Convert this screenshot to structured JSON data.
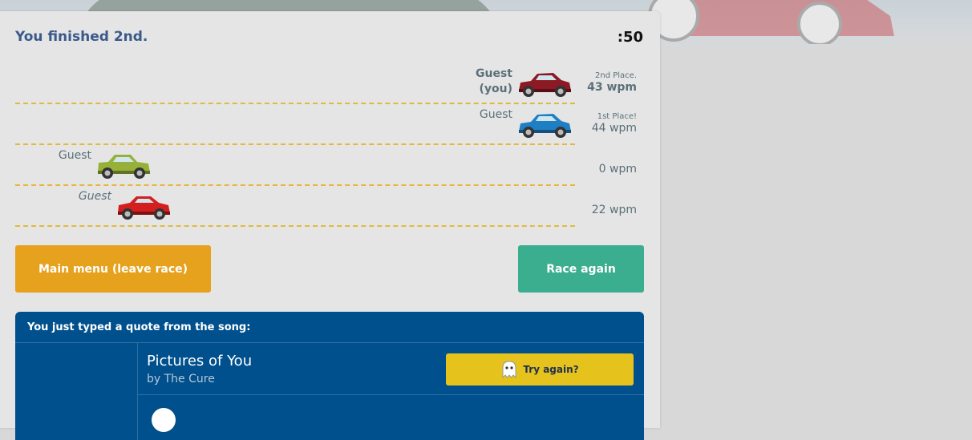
{
  "header": {
    "status": "You finished 2nd.",
    "timer": ":50"
  },
  "lanes": [
    {
      "name_line1": "Guest",
      "name_line2": "(you)",
      "car_color": "#8b1a24",
      "place": "2nd Place.",
      "wpm": "43 wpm"
    },
    {
      "name_line1": "Guest",
      "car_color": "#1f7fc4",
      "place": "1st Place!",
      "wpm": "44 wpm"
    },
    {
      "name_line1": "Guest",
      "car_color": "#97b03a",
      "place": "",
      "wpm": "0 wpm"
    },
    {
      "name_line1": "Guest",
      "car_color": "#d41f1f",
      "place": "",
      "wpm": "22 wpm"
    }
  ],
  "buttons": {
    "main_menu": "Main menu (leave race)",
    "race_again": "Race again"
  },
  "quote": {
    "header": "You just typed a quote from the song:",
    "song_title": "Pictures of You",
    "by_prefix": "by ",
    "artist": "The Cure",
    "try_again": "Try again?"
  },
  "colors": {
    "title": "#3a5a8a",
    "lane_divider": "#e2b93b",
    "menu_button": "#e6a11d",
    "race_again_button": "#3aae8e",
    "quote_panel": "#00508d",
    "try_again_button": "#e5c21c"
  },
  "icons": {
    "try_again": "ghost-icon"
  }
}
